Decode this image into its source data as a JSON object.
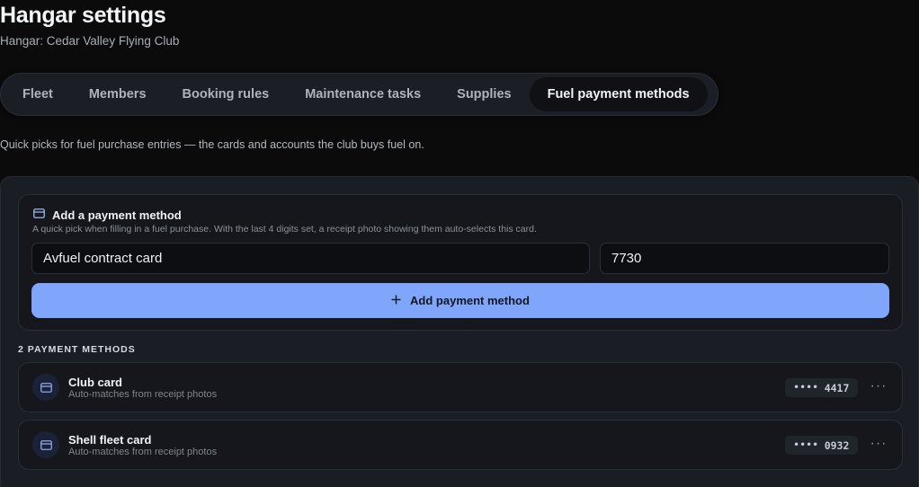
{
  "header": {
    "title": "Hangar settings",
    "subtitle": "Hangar: Cedar Valley Flying Club"
  },
  "tabs": [
    {
      "label": "Fleet",
      "active": false
    },
    {
      "label": "Members",
      "active": false
    },
    {
      "label": "Booking rules",
      "active": false
    },
    {
      "label": "Maintenance tasks",
      "active": false
    },
    {
      "label": "Supplies",
      "active": false
    },
    {
      "label": "Fuel payment methods",
      "active": true
    }
  ],
  "intro": "Quick picks for fuel purchase entries — the cards and accounts the club buys fuel on.",
  "add_form": {
    "icon": "credit-card-icon",
    "title": "Add a payment method",
    "hint": "A quick pick when filling in a fuel purchase. With the last 4 digits set, a receipt photo showing them auto-selects this card.",
    "name_value": "Avfuel contract card",
    "digits_value": "7730",
    "button_icon": "plus-icon",
    "button_label": "Add payment method"
  },
  "methods_label": "2 PAYMENT METHODS",
  "methods": [
    {
      "name": "Club card",
      "subtitle": "Auto-matches from receipt photos",
      "mask": "••••",
      "last4": "4417",
      "icon": "credit-card-icon"
    },
    {
      "name": "Shell fleet card",
      "subtitle": "Auto-matches from receipt photos",
      "mask": "••••",
      "last4": "0932",
      "icon": "credit-card-icon"
    }
  ],
  "more_glyph": "···",
  "colors": {
    "background": "#0b0b0c",
    "accent": "#7fa6fb",
    "panel": "#1a1d23"
  }
}
